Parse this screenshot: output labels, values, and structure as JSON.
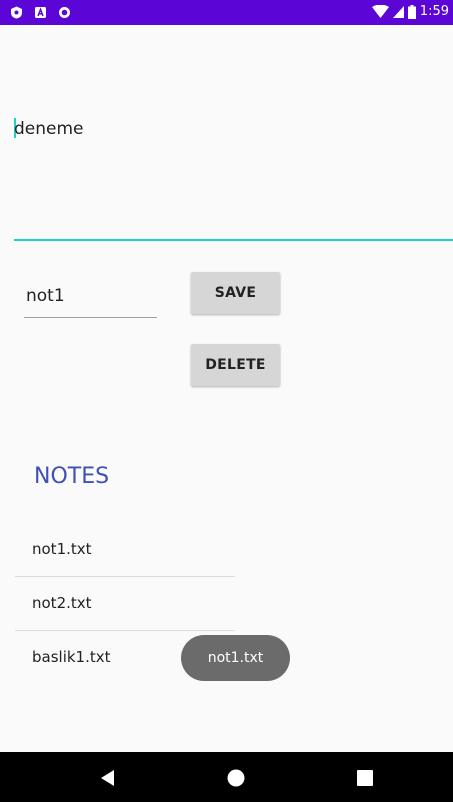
{
  "status_bar": {
    "time": "1:59",
    "icons": [
      "shield-icon",
      "a-icon",
      "circle-icon",
      "wifi-icon",
      "signal-icon",
      "battery-icon"
    ]
  },
  "editor": {
    "note_content": "deneme",
    "note_name": "not1"
  },
  "buttons": {
    "save_label": "SAVE",
    "delete_label": "DELETE"
  },
  "notes": {
    "title": "NOTES",
    "items": [
      {
        "label": "not1.txt"
      },
      {
        "label": "not2.txt"
      },
      {
        "label": "baslik1.txt"
      }
    ]
  },
  "toast": {
    "text": "not1.txt"
  },
  "nav_bar": {
    "icons": [
      "back-icon",
      "home-icon",
      "recents-icon"
    ]
  },
  "colors": {
    "status_bar": "#5b06d6",
    "accent": "#1fd1c3",
    "title": "#3f51b5",
    "button": "#d6d6d6",
    "toast": "#6b6b6b"
  }
}
